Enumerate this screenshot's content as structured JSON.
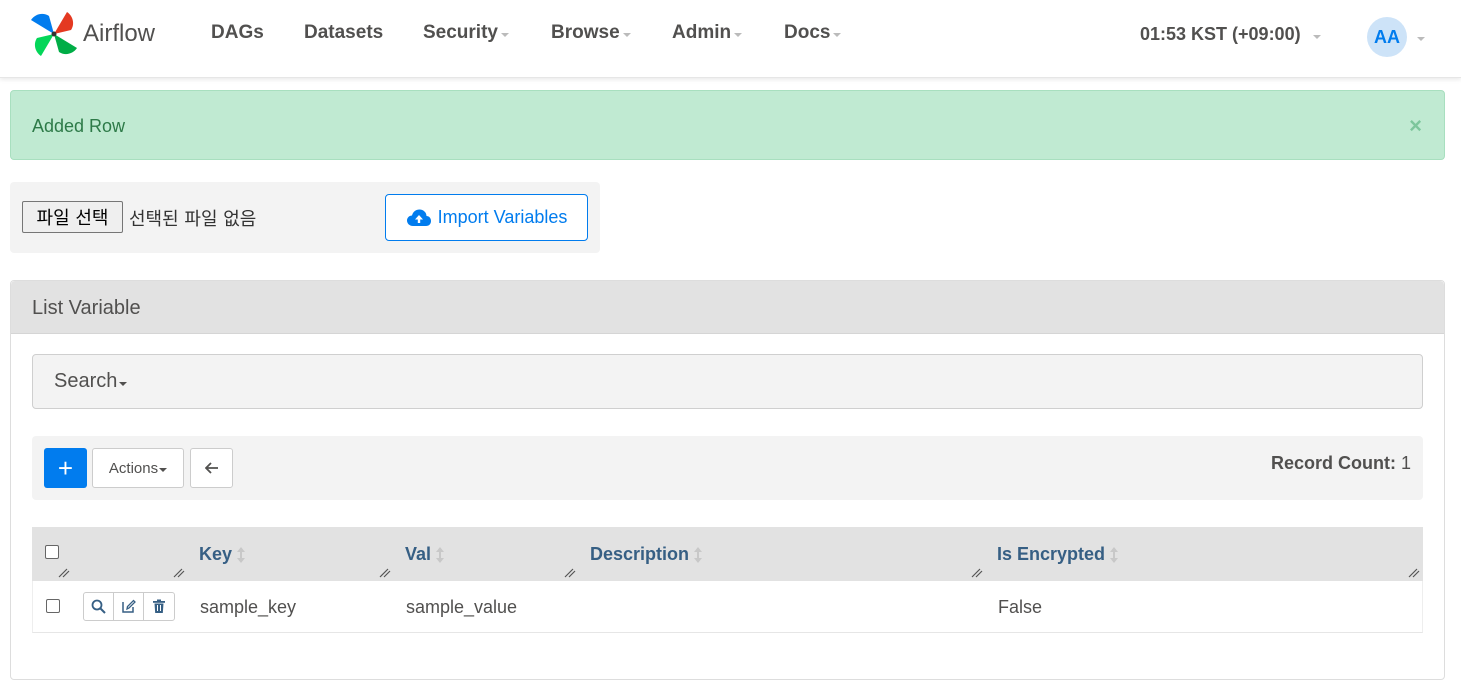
{
  "navbar": {
    "brand": "Airflow",
    "items": [
      {
        "label": "DAGs",
        "dropdown": false
      },
      {
        "label": "Datasets",
        "dropdown": false
      },
      {
        "label": "Security",
        "dropdown": true
      },
      {
        "label": "Browse",
        "dropdown": true
      },
      {
        "label": "Admin",
        "dropdown": true
      },
      {
        "label": "Docs",
        "dropdown": true
      }
    ],
    "clock": "01:53 KST (+09:00)",
    "user_initials": "AA"
  },
  "alert": {
    "message": "Added Row",
    "close": "×",
    "color": "#c0ead2"
  },
  "import": {
    "file_button": "파일 선택",
    "file_status": "선택된 파일 없음",
    "import_button": "Import Variables"
  },
  "panel": {
    "title": "List Variable",
    "search_label": "Search",
    "actions_label": "Actions",
    "add_label": "+",
    "record_count_label": "Record Count:",
    "record_count_value": "1"
  },
  "table": {
    "columns": [
      "Key",
      "Val",
      "Description",
      "Is Encrypted"
    ],
    "rows": [
      {
        "key": "sample_key",
        "val": "sample_value",
        "description": "",
        "is_encrypted": "False"
      }
    ]
  },
  "colors": {
    "accent": "#017cee",
    "header_text": "#365f84",
    "success_bg": "#c0ead2"
  }
}
